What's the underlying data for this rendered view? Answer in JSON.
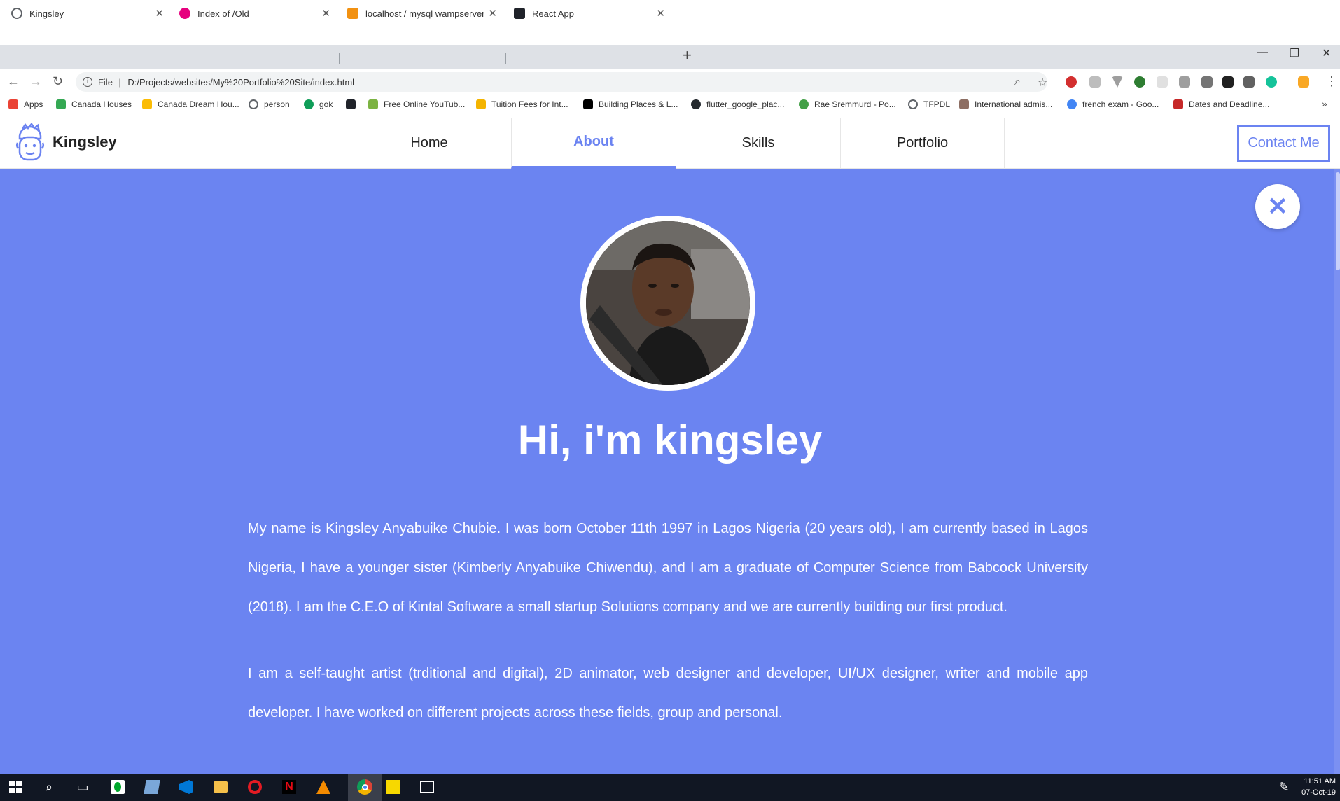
{
  "browser": {
    "tabs": [
      {
        "title": "Kingsley",
        "icon": "globe-icon",
        "color": "#5f6368"
      },
      {
        "title": "Index of /Old",
        "icon": "wamp-icon",
        "color": "#e6007e"
      },
      {
        "title": "localhost / mysql wampserver / s",
        "icon": "phpmyadmin-icon",
        "color": "#f29111"
      },
      {
        "title": "React App",
        "icon": "react-icon",
        "color": "#20232a"
      }
    ],
    "address": {
      "scheme_label": "File",
      "url": "D:/Projects/websites/My%20Portfolio%20Site/index.html"
    },
    "bookmarks": [
      {
        "label": "Apps",
        "icon": "apps-grid-icon",
        "color": "#ea4335"
      },
      {
        "label": "Canada Houses",
        "icon": "house-icon",
        "color": "#34a853"
      },
      {
        "label": "Canada Dream Hou...",
        "icon": "house-icon",
        "color": "#fbbc05"
      },
      {
        "label": "person",
        "icon": "globe-icon",
        "color": "#5f6368"
      },
      {
        "label": "gok",
        "icon": "gok-icon",
        "color": "#0f9d58"
      },
      {
        "label": "",
        "icon": "react-icon",
        "color": "#20232a"
      },
      {
        "label": "Free Online YouTub...",
        "icon": "download-icon",
        "color": "#7cb342"
      },
      {
        "label": "Tuition Fees for Int...",
        "icon": "star-icon",
        "color": "#f4b400"
      },
      {
        "label": "Building Places & L...",
        "icon": "medium-icon",
        "color": "#000000"
      },
      {
        "label": "flutter_google_plac...",
        "icon": "github-icon",
        "color": "#24292e"
      },
      {
        "label": "Rae Sremmurd - Po...",
        "icon": "music-icon",
        "color": "#43a047"
      },
      {
        "label": "TFPDL",
        "icon": "globe-icon",
        "color": "#5f6368"
      },
      {
        "label": "International admis...",
        "icon": "shield-icon",
        "color": "#8d6e63"
      },
      {
        "label": "french exam - Goo...",
        "icon": "google-icon",
        "color": "#4285f4"
      },
      {
        "label": "Dates and Deadline...",
        "icon": "crest-icon",
        "color": "#c62828"
      }
    ]
  },
  "site": {
    "brand": "Kingsley",
    "nav": [
      {
        "label": "Home",
        "active": false
      },
      {
        "label": "About",
        "active": true
      },
      {
        "label": "Skills",
        "active": false
      },
      {
        "label": "Portfolio",
        "active": false
      }
    ],
    "contact_label": "Contact Me",
    "accent": "#6b84f1"
  },
  "about": {
    "headline": "Hi, i'm kingsley",
    "paragraphs": [
      "My name is Kingsley Anyabuike Chubie. I was born October 11th 1997 in Lagos Nigeria (20 years old), I am currently based in Lagos Nigeria, I have a younger sister (Kimberly Anyabuike Chiwendu), and I am a graduate of Computer Science from Babcock University (2018). I am the C.E.O of Kintal Software a small startup Solutions company and we are currently building our first product.",
      "I am a self-taught artist (trditional and digital), 2D animator, web designer and developer, UI/UX designer, writer and mobile app developer. I have worked on different projects across these fields, group and personal."
    ]
  },
  "taskbar": {
    "time": "11:51 AM",
    "date": "07-Oct-19"
  }
}
